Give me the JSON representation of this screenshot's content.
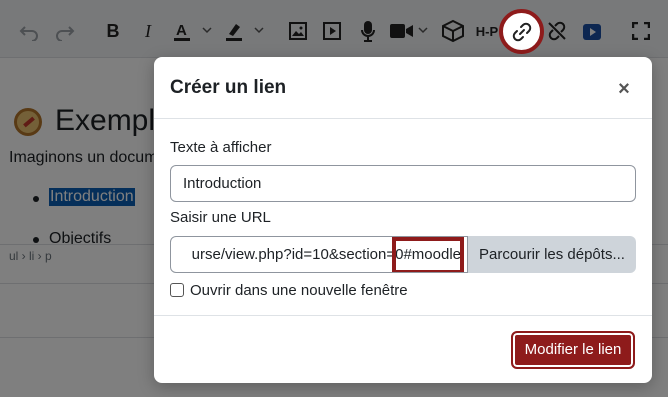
{
  "editor": {
    "heading": "Exemple",
    "paragraph": "Imaginons un docum",
    "list_item_1": "Introduction",
    "list_item_2": "Objectifs",
    "path": "ul › li › p",
    "toolbar": {
      "bold": "B",
      "italic": "I",
      "h5p": "H-P"
    }
  },
  "dialog": {
    "title": "Créer un lien",
    "close": "×",
    "text_label": "Texte à afficher",
    "text_value": "Introduction",
    "url_label": "Saisir une URL",
    "url_value": "urse/view.php?id=10&section=0#moodle",
    "browse_label": "Parcourir les dépôts...",
    "checkbox_label": "Ouvrir dans une nouvelle fenêtre",
    "submit_label": "Modifier le lien"
  },
  "colors": {
    "accent": "#8e1b1b",
    "selection": "#0a5fb4"
  }
}
